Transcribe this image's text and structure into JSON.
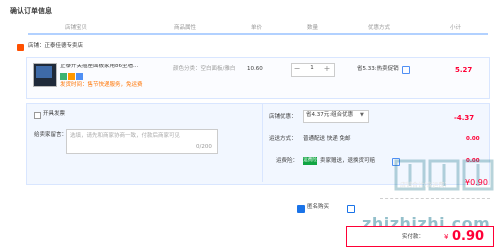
{
  "page": {
    "title": "确认订单信息"
  },
  "table_headers": [
    "店铺宝贝",
    "商品属性",
    "单价",
    "数量",
    "优惠方式",
    "小计"
  ],
  "shop": {
    "label": "店铺：",
    "name": "正泰佳德专卖店"
  },
  "item": {
    "name": "正泰开关插座面板家用86型墙...",
    "promo": "发货时间：售节快递服务，免运费",
    "attributes": "颜色分类：空白面板/雅白",
    "unit_price": "10.60",
    "quantity": "1",
    "discount": "省5.33:热卖促销",
    "subtotal": "5.27"
  },
  "options": {
    "invoice_label": "开具发票",
    "message_label": "给卖家留言：",
    "message_placeholder": "选填，请先和商家协商一致，付款后商家可见",
    "message_count": "0/200"
  },
  "shop_discount": {
    "label": "店铺优惠：",
    "selected": "省4.37元:组合优惠",
    "value": "-4.37"
  },
  "shipping": {
    "label": "运送方式：",
    "text": "普通配送 快递 免邮",
    "value": "0.00"
  },
  "insurance": {
    "label": "运费险：",
    "badge": "运费险",
    "text": "卖家赠送，退换货可赔",
    "value": "0.00"
  },
  "watermark": {
    "text": "店铺合计(含运费)",
    "amount": "¥0.90",
    "url": "zhizhizhi.com"
  },
  "checkout": {
    "anonymous_label": "匿名购买",
    "pay_label": "实付款：",
    "currency": "¥",
    "total": "0.90"
  },
  "colors": {
    "accent": "#ff0036",
    "blue": "#1a73e8",
    "orange": "#ff5000"
  }
}
